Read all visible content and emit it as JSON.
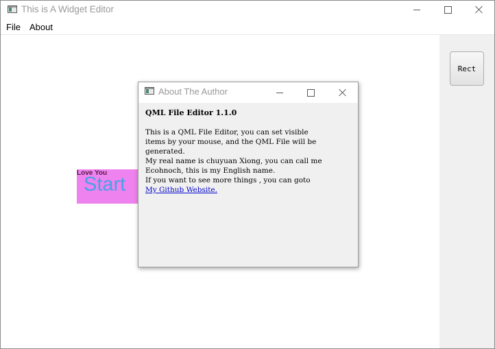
{
  "window": {
    "title": "This is A Widget Editor"
  },
  "menubar": {
    "items": [
      {
        "label": "File"
      },
      {
        "label": "About"
      }
    ]
  },
  "side_panel": {
    "rect_button_label": "Rect"
  },
  "widget": {
    "caption": "Love You",
    "text": "Start"
  },
  "dialog": {
    "title": "About The Author",
    "heading": "QML File Editor 1.1.0",
    "lines": [
      "This is a QML File Editor, you can set visible",
      "items by your mouse, and the QML File will be",
      "generated.",
      "My real name is chuyuan Xiong, you can call me",
      "Ecohnoch, this is my English name.",
      "If you want to see more things , you can goto"
    ],
    "link_label": "My Github Website."
  },
  "colors": {
    "widget_background": "#ee82ee",
    "widget_text": "#4aa0e6",
    "link": "#0000cc"
  }
}
